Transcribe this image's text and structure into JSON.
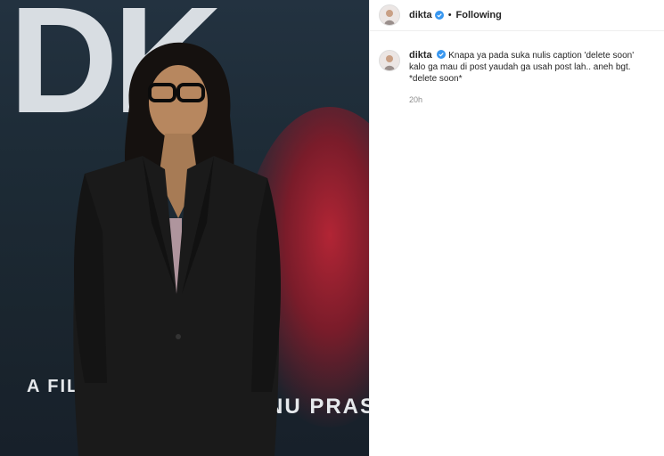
{
  "media": {
    "poster_title": "DK",
    "poster_credit_left": "A FIL",
    "poster_credit_right": "NU PRAS"
  },
  "header": {
    "username": "dikta",
    "verified": true,
    "follow_label": "Following"
  },
  "caption": {
    "username": "dikta",
    "text": "Knapa ya pada suka nulis caption 'delete soon' kalo ga mau di post yaudah ga usah post lah.. aneh bgt. *delete soon*",
    "time": "20h"
  },
  "colors": {
    "verified_badge": "#3897f0",
    "secondary_text": "#8e8e8e"
  }
}
